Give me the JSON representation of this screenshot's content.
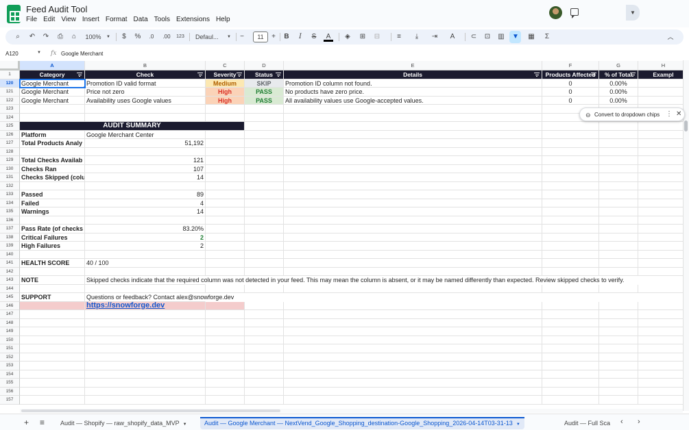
{
  "app": {
    "title": "Feed Audit Tool",
    "menu": [
      "File",
      "Edit",
      "View",
      "Insert",
      "Format",
      "Data",
      "Tools",
      "Extensions",
      "Help"
    ]
  },
  "toolbar": {
    "zoom": "100%",
    "currency": "$",
    "percent": "%",
    "decrease_decimal": ".0",
    "increase_decimal": ".00",
    "number_format": "123",
    "font": "Defaul...",
    "font_size": "11",
    "minus": "−",
    "plus": "+",
    "bold": "B",
    "italic": "I",
    "strike": "S",
    "text_color": "A",
    "sum": "Σ"
  },
  "formula_bar": {
    "cell_ref": "A120",
    "fx": "fx",
    "value": "Google Merchant"
  },
  "columns": [
    {
      "letter": "A",
      "header": "Category"
    },
    {
      "letter": "B",
      "header": "Check"
    },
    {
      "letter": "C",
      "header": "Severity"
    },
    {
      "letter": "D",
      "header": "Status"
    },
    {
      "letter": "E",
      "header": "Details"
    },
    {
      "letter": "F",
      "header": "Products Affected"
    },
    {
      "letter": "G",
      "header": "% of Total"
    },
    {
      "letter": "H",
      "header": "Exampl"
    }
  ],
  "row_numbers": [
    "1",
    "120",
    "121",
    "122",
    "123",
    "124",
    "125",
    "126",
    "127",
    "128",
    "129",
    "130",
    "131",
    "132",
    "133",
    "134",
    "135",
    "136",
    "137",
    "138",
    "139",
    "140",
    "141",
    "142",
    "143",
    "144",
    "145",
    "146",
    "147",
    "148",
    "149",
    "150",
    "151",
    "152",
    "153",
    "154",
    "155",
    "156",
    "157"
  ],
  "audit_rows": [
    {
      "category": "Google Merchant",
      "check": "Promotion ID valid format",
      "severity": "Medium",
      "status": "SKIP",
      "details": "Promotion ID column not found.",
      "affected": "0",
      "pct": "0.00%"
    },
    {
      "category": "Google Merchant",
      "check": "Price not zero",
      "severity": "High",
      "status": "PASS",
      "details": "No products have zero price.",
      "affected": "0",
      "pct": "0.00%"
    },
    {
      "category": "Google Merchant",
      "check": "Availability uses Google values",
      "severity": "High",
      "status": "PASS",
      "details": "All availability values use Google-accepted values.",
      "affected": "0",
      "pct": "0.00%"
    }
  ],
  "summary": {
    "title": "AUDIT SUMMARY",
    "platform_label": "Platform",
    "platform_value": "Google Merchant Center",
    "total_products_label": "Total Products Analy",
    "total_products_value": "51,192",
    "total_checks_label": "Total Checks Availab",
    "total_checks_value": "121",
    "checks_ran_label": "Checks Ran",
    "checks_ran_value": "107",
    "checks_skipped_label": "Checks Skipped (colu",
    "checks_skipped_value": "14",
    "passed_label": "Passed",
    "passed_value": "89",
    "failed_label": "Failed",
    "failed_value": "4",
    "warnings_label": "Warnings",
    "warnings_value": "14",
    "pass_rate_label": "Pass Rate (of checks",
    "pass_rate_value": "83.20%",
    "critical_label": "Critical Failures",
    "critical_value": "2",
    "high_label": "High Failures",
    "high_value": "2",
    "health_label": "HEALTH SCORE",
    "health_value": "40 / 100",
    "note_label": "NOTE",
    "note_value": "Skipped checks indicate that the required column was not detected in your feed. This may mean the column is absent, or it may be named differently than expected. Review skipped checks to verify.",
    "support_label": "SUPPORT",
    "support_value": "Questions or feedback? Contact alex@snowforge.dev",
    "link": "https://snowforge.dev"
  },
  "chip_popup": {
    "label": "Convert to dropdown chips"
  },
  "sheet_tabs": [
    {
      "label": "Audit — Shopify — raw_shopify_data_MVP",
      "active": false
    },
    {
      "label": "Audit — Google Merchant — NextVend_Google_Shopping_destination-Google_Shopping_2026-04-14T03-31-13",
      "active": true
    },
    {
      "label": "Audit — Full Sca",
      "active": false
    }
  ],
  "colors": {
    "header_dark": "#1b1b2f",
    "medium_bg": "#fce8b2",
    "high_bg": "#fbd3b8",
    "pass_bg": "#d9ead3",
    "skip_bg": "#e8eaed",
    "link": "#1155cc",
    "pink": "#f4cccc"
  }
}
